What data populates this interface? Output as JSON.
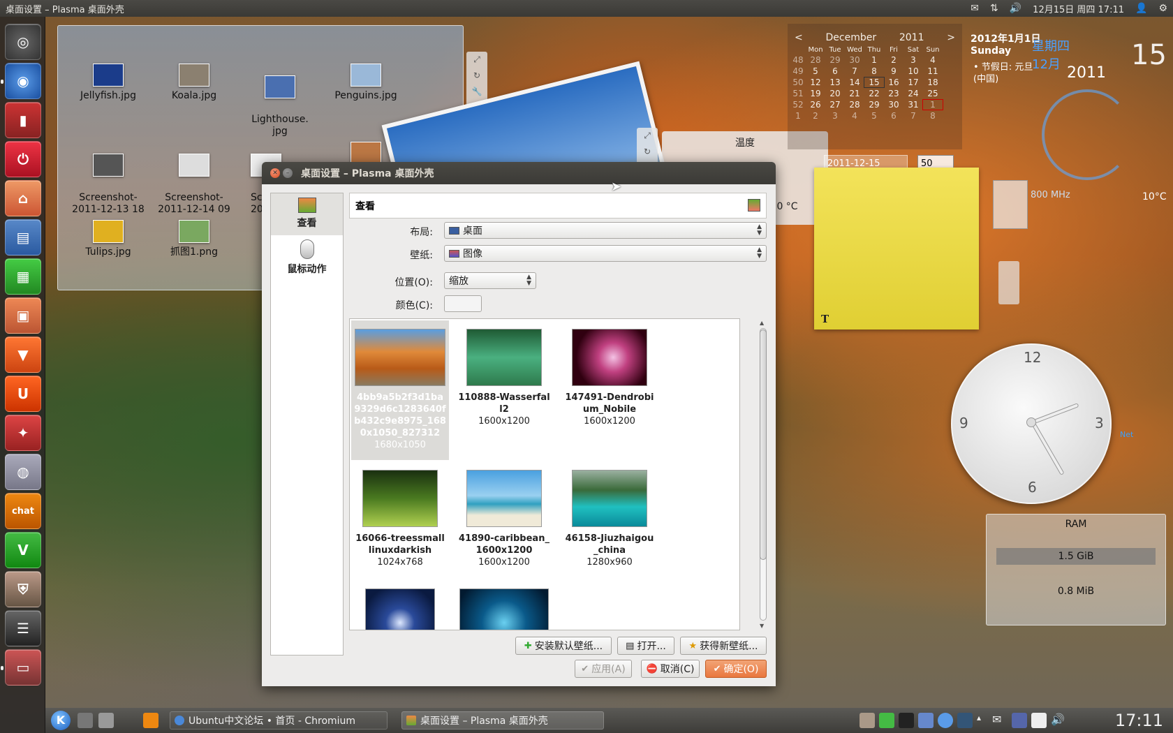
{
  "top_panel": {
    "title": "桌面设置 – Plasma 桌面外壳",
    "datetime": "12月15日 周四 17:11",
    "icons": [
      "mail-icon",
      "network-icon",
      "volume-icon",
      "user-icon",
      "gear-icon"
    ]
  },
  "launcher": {
    "items": [
      "dash-home",
      "chromium",
      "ubuntu-one",
      "shutdown",
      "home-folder",
      "writer",
      "calc",
      "impress",
      "software-center",
      "ubuntu-one-u",
      "settings",
      "webcam",
      "chat",
      "vim",
      "security",
      "files",
      "display"
    ]
  },
  "folder_view": {
    "items": [
      {
        "label": "Jellyfish.jpg",
        "color": "#1b3c8a"
      },
      {
        "label": "Koala.jpg",
        "color": "#8b8070"
      },
      {
        "label": "Lighthouse.\njpg",
        "color": "#4a6fb0"
      },
      {
        "label": "Penguins.jpg",
        "color": "#9ab8d8"
      },
      {
        "label": "Screenshot-\n2011-12-13 18",
        "color": "#555555"
      },
      {
        "label": "Screenshot-\n2011-12-14 09",
        "color": "#dddddd"
      },
      {
        "label": "Sc\n201",
        "color": "#eeeeee"
      },
      {
        "label": "",
        "color": "#bb7744"
      },
      {
        "label": "Tulips.jpg",
        "color": "#e0b020"
      },
      {
        "label": "抓图1.png",
        "color": "#7aa860"
      }
    ]
  },
  "temperature_widget": {
    "title": "温度",
    "value": ".0 °C"
  },
  "calendar": {
    "prev": "<",
    "next": ">",
    "month": "December",
    "year": "2011",
    "dow": [
      "Mon",
      "Tue",
      "Wed",
      "Thu",
      "Fri",
      "Sat",
      "Sun"
    ],
    "weeks": [
      {
        "wk": "48",
        "days": [
          "28",
          "29",
          "30",
          "1",
          "2",
          "3",
          "4"
        ]
      },
      {
        "wk": "49",
        "days": [
          "5",
          "6",
          "7",
          "8",
          "9",
          "10",
          "11"
        ]
      },
      {
        "wk": "50",
        "days": [
          "12",
          "13",
          "14",
          "15",
          "16",
          "17",
          "18"
        ]
      },
      {
        "wk": "51",
        "days": [
          "19",
          "20",
          "21",
          "22",
          "23",
          "24",
          "25"
        ]
      },
      {
        "wk": "52",
        "days": [
          "26",
          "27",
          "28",
          "29",
          "30",
          "31",
          "1"
        ]
      },
      {
        "wk": "1",
        "days": [
          "2",
          "3",
          "4",
          "5",
          "6",
          "7",
          "8"
        ]
      }
    ],
    "info_date": "2012年1月1日",
    "info_weekday": "Sunday",
    "holiday": "• 节假日: 元旦\n(中国)",
    "date_input": "2011-12-15",
    "num_input": "50"
  },
  "desktop_clock": {
    "big_time": "15",
    "weekday": "星期四\n12月",
    "year": "2011"
  },
  "system_monitor": {
    "cpu_freq": "800 MHz",
    "temp": "10°C",
    "net_label": "Net"
  },
  "analog_clock": {
    "n12": "12",
    "n3": "3",
    "n6": "6",
    "n9": "9"
  },
  "ram_widget": {
    "title": "RAM",
    "used": "1.5 GiB",
    "free": "0.8 MiB"
  },
  "dialog": {
    "title": "桌面设置 – Plasma 桌面外壳",
    "sidebar": [
      {
        "label": "查看"
      },
      {
        "label": "鼠标动作"
      }
    ],
    "header": "查看",
    "layout_label": "布局:",
    "layout_value": "桌面",
    "wallpaper_label": "壁纸:",
    "wallpaper_value": "图像",
    "position_label": "位置(O):",
    "position_value": "缩放",
    "color_label": "颜色(C):",
    "wallpapers": [
      {
        "name": "4bb9a5b2f3d1ba9329d6c1283640fb432c9e8975_1680x1050_827312",
        "res": "1680x1050",
        "color": "#c8641e"
      },
      {
        "name": "110888-Wasserfall2",
        "res": "1600x1200",
        "color": "#2e7a4c"
      },
      {
        "name": "147491-Dendrobium_Nobile",
        "res": "1600x1200",
        "color": "#b8306a"
      },
      {
        "name": "16066-treessmalllinuxdarkish",
        "res": "1024x768",
        "color": "#5a9a2a"
      },
      {
        "name": "41890-caribbean_1600x1200",
        "res": "1600x1200",
        "color": "#3a9ad0"
      },
      {
        "name": "46158-Jiuzhaigou_china",
        "res": "1280x960",
        "color": "#1ab0b0"
      },
      {
        "name": "",
        "res": "",
        "color": "#1a2a5a"
      },
      {
        "name": "",
        "res": "",
        "color": "#0a3a5a"
      }
    ],
    "btn_install": "安装默认壁纸...",
    "btn_open": "打开...",
    "btn_get_new": "获得新壁纸...",
    "btn_apply": "应用(A)",
    "btn_cancel": "取消(C)",
    "btn_ok": "确定(O)"
  },
  "taskbar": {
    "tasks": [
      {
        "label": "Ubuntu中文论坛 • 首页 - Chromium"
      },
      {
        "label": "桌面设置 – Plasma 桌面外壳"
      }
    ],
    "clock": "17:11"
  }
}
